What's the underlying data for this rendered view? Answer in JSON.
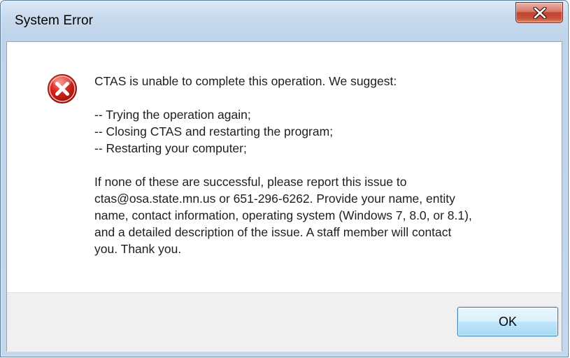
{
  "window": {
    "title": "System Error"
  },
  "icons": {
    "close": "close-icon",
    "error": "error-icon"
  },
  "message": {
    "intro": "CTAS is unable to complete this operation.  We suggest:",
    "suggestions": "-- Trying the operation again;\n-- Closing CTAS and restarting the program;\n-- Restarting your computer;",
    "contact": "If none of these are successful, please report this issue to\nctas@osa.state.mn.us or 651-296-6262. Provide your name, entity\nname, contact information, operating system (Windows 7, 8.0, or 8.1),\nand a detailed description of the issue.  A staff member will contact\nyou.  Thank you."
  },
  "buttons": {
    "ok_label": "OK"
  },
  "colors": {
    "error_red": "#c8201a",
    "close_button_red": "#c7533c",
    "ok_button_border": "#3c7fb1",
    "title_bar": "#c9dbee"
  }
}
